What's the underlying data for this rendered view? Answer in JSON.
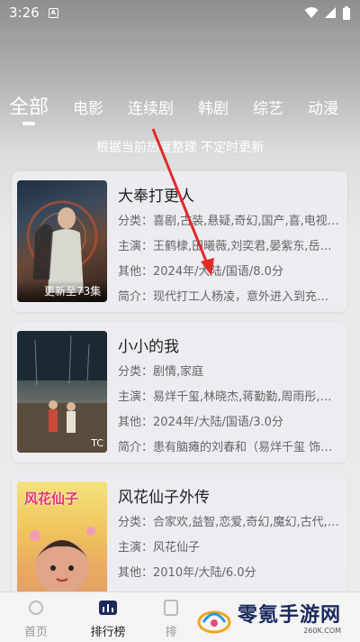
{
  "status_bar": {
    "time": "3:26",
    "badge": "A"
  },
  "tabs": [
    {
      "label": "全部",
      "active": true
    },
    {
      "label": "电影"
    },
    {
      "label": "连续剧"
    },
    {
      "label": "韩剧"
    },
    {
      "label": "综艺"
    },
    {
      "label": "动漫"
    }
  ],
  "subtitle": "根据当前热度整理 不定时更新",
  "items": [
    {
      "title": "大奉打更人",
      "genre": "分类：喜剧,古装,悬疑,奇幻,国产,喜,电视…",
      "cast": "主演：王鹤棣,田曦薇,刘奕君,晏紫东,岳…",
      "other": "其他：2024年/大陆/国语/8.0分",
      "intro": "简介：现代打工人杨凌，意外进入到充…",
      "poster_tag": "更新至73集"
    },
    {
      "title": "小小的我",
      "genre": "分类：剧情,家庭",
      "cast": "主演：易烊千玺,林晓杰,蒋勤勤,周雨彤,…",
      "other": "其他：2024年/大陆/国语/3.0分",
      "intro": "简介：患有脑瘫的刘春和（易烊千玺 饰…",
      "poster_mark": "TC"
    },
    {
      "title": "风花仙子外传",
      "genre": "分类：合家欢,益智,恋爱,奇幻,魔幻,古代,…",
      "cast": "主演：风花仙子",
      "other": "其他：2010年/大陆/6.0分",
      "poster_logo": "风花仙子"
    }
  ],
  "bottom_nav": [
    {
      "label": "首页",
      "icon": "home-icon"
    },
    {
      "label": "排行榜",
      "icon": "ranking-icon",
      "active": true
    },
    {
      "label": "排",
      "icon": "list-icon"
    }
  ],
  "watermark": {
    "name": "零氪手游网",
    "url": "260K.COM"
  }
}
